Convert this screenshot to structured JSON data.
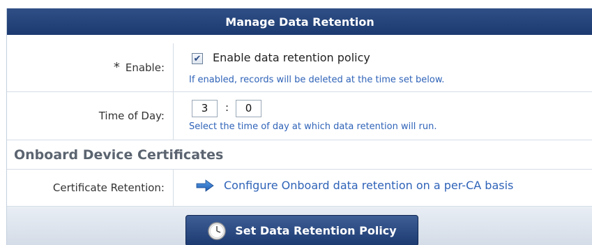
{
  "header": {
    "title": "Manage Data Retention"
  },
  "enable_row": {
    "required_marker": "*",
    "label": "Enable:",
    "checked": true,
    "checkbox_label": "Enable data retention policy",
    "hint": "If enabled, records will be deleted at the time set below."
  },
  "time_row": {
    "label": "Time of Day:",
    "hour": "3",
    "separator": ":",
    "minute": "0",
    "hint": "Select the time of day at which data retention will run."
  },
  "section": {
    "title": "Onboard Device Certificates"
  },
  "cert_row": {
    "label": "Certificate Retention:",
    "link_text": "Configure Onboard data retention on a per-CA basis",
    "link_icon": "arrow-right-icon"
  },
  "footer": {
    "button_label": "Set Data Retention Policy",
    "button_icon": "clock-icon"
  },
  "colors": {
    "header_bg": "#1c3a70",
    "link": "#2f63b8",
    "section_title": "#5b6470"
  }
}
